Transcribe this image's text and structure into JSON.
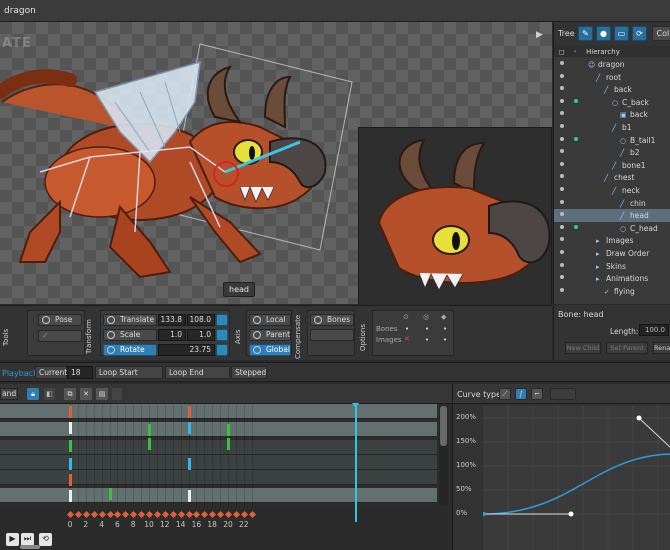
{
  "window": {
    "title": "dragon"
  },
  "viewport": {
    "watermark": "ATE",
    "selected_bone_tag": "head"
  },
  "tree": {
    "tab": "Tree",
    "collapse_label": "Coll",
    "hierarchy_label": "Hierarchy",
    "items": [
      {
        "label": "dragon",
        "indent": 0,
        "icon": "person",
        "selected": false,
        "key": false
      },
      {
        "label": "root",
        "indent": 1,
        "icon": "bone",
        "selected": false,
        "key": false
      },
      {
        "label": "back",
        "indent": 2,
        "icon": "bone",
        "selected": false,
        "key": false
      },
      {
        "label": "C_back",
        "indent": 3,
        "icon": "slot",
        "selected": false,
        "key": true
      },
      {
        "label": "back",
        "indent": 4,
        "icon": "image",
        "selected": false,
        "key": false
      },
      {
        "label": "b1",
        "indent": 3,
        "icon": "bone",
        "selected": false,
        "key": false
      },
      {
        "label": "B_tail1",
        "indent": 4,
        "icon": "slot",
        "selected": false,
        "key": true
      },
      {
        "label": "b2",
        "indent": 4,
        "icon": "bone",
        "selected": false,
        "key": false
      },
      {
        "label": "bone1",
        "indent": 3,
        "icon": "bone",
        "selected": false,
        "key": false
      },
      {
        "label": "chest",
        "indent": 2,
        "icon": "bone",
        "selected": false,
        "key": false
      },
      {
        "label": "neck",
        "indent": 3,
        "icon": "bone",
        "selected": false,
        "key": false
      },
      {
        "label": "chin",
        "indent": 4,
        "icon": "bone",
        "selected": false,
        "key": false
      },
      {
        "label": "head",
        "indent": 4,
        "icon": "bone",
        "selected": true,
        "key": false
      },
      {
        "label": "C_head",
        "indent": 4,
        "icon": "slot",
        "selected": false,
        "key": true
      },
      {
        "label": "Images",
        "indent": 1,
        "icon": "folder",
        "selected": false,
        "key": false
      },
      {
        "label": "Draw Order",
        "indent": 1,
        "icon": "folder",
        "selected": false,
        "key": false
      },
      {
        "label": "Skins",
        "indent": 1,
        "icon": "folder",
        "selected": false,
        "key": false
      },
      {
        "label": "Animations",
        "indent": 1,
        "icon": "folder",
        "selected": false,
        "key": false
      },
      {
        "label": "flying",
        "indent": 2,
        "icon": "anim",
        "selected": false,
        "key": false
      }
    ]
  },
  "bone_info": {
    "title": "Bone: head",
    "length_label": "Length:",
    "length_value": "100.0",
    "buttons": [
      "New Child",
      "Set Parent",
      "Rename"
    ]
  },
  "toolbar": {
    "tools_label": "Tools",
    "pose": "Pose",
    "transform_label": "Transform",
    "translate": "Translate",
    "translate_x": "133.8",
    "translate_y": "108.0",
    "scale": "Scale",
    "scale_x": "1.0",
    "scale_y": "1.0",
    "rotate": "Rotate",
    "rotate_value": "23.75",
    "axis_label": "Axis",
    "local": "Local",
    "parent": "Parent",
    "global": "Global",
    "compensate_label": "Compensate",
    "bones": "Bones",
    "options_label": "Options",
    "opt_bones": "Bones",
    "opt_images": "Images"
  },
  "playback": {
    "label": "Playback",
    "current_label": "Current",
    "current_value": "18",
    "loop_start": "Loop Start",
    "loop_end": "Loop End",
    "stepped": "Stepped"
  },
  "dopesheet": {
    "expand_label": "and",
    "ticks": [
      "0",
      "2",
      "4",
      "6",
      "8",
      "10",
      "12",
      "14",
      "16",
      "18",
      "20",
      "22"
    ],
    "current_frame": 18
  },
  "curve": {
    "label": "Curve type:",
    "y_ticks": [
      "200%",
      "150%",
      "100%",
      "50%",
      "0%"
    ]
  },
  "colors": {
    "accent": "#2f7fb5",
    "playhead": "#2fc7e0",
    "rotate_key": "#3fbf3f",
    "translate_key": "#34b8e8",
    "scale_key": "#e0603a"
  }
}
